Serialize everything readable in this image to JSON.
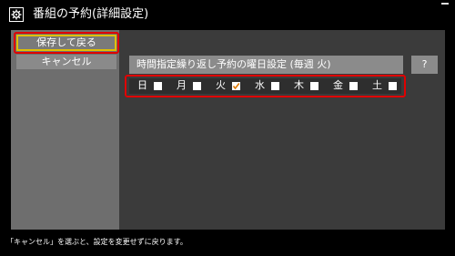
{
  "window": {
    "title": "番組の予約(詳細設定)",
    "app_icon": "gear-icon"
  },
  "sidebar": {
    "save_label": "保存して戻る",
    "cancel_label": "キャンセル"
  },
  "main": {
    "header": "時間指定繰り返し予約の曜日設定 (毎週 火)",
    "help_label": "?"
  },
  "days": [
    {
      "label": "日",
      "checked": false
    },
    {
      "label": "月",
      "checked": false
    },
    {
      "label": "火",
      "checked": true
    },
    {
      "label": "水",
      "checked": false
    },
    {
      "label": "木",
      "checked": false
    },
    {
      "label": "金",
      "checked": false
    },
    {
      "label": "土",
      "checked": false
    }
  ],
  "status": {
    "text": "「キャンセル」を選ぶと、設定を変更せずに戻ります。"
  },
  "colors": {
    "highlight": "#e00000",
    "focus": "#e0c000",
    "check": "#e07800"
  }
}
